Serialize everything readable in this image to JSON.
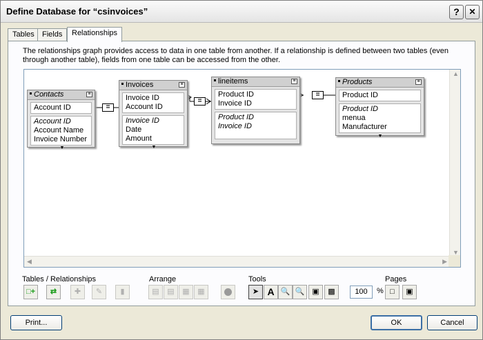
{
  "window": {
    "title": "Define Database for “csinvoices”",
    "help_btn": "?",
    "close_btn": "✕"
  },
  "tabs": [
    {
      "label": "Tables"
    },
    {
      "label": "Fields"
    },
    {
      "label": "Relationships",
      "active": true
    }
  ],
  "description": "The relationships graph provides access to data in one table from another. If a relationship is defined between two tables (even through another table), fields from one table can be accessed from the other.",
  "graph": {
    "tables": [
      {
        "name": "Contacts",
        "italic": true,
        "keys": [
          "Account ID"
        ],
        "fields": [
          "Account ID",
          "Account Name",
          "Invoice Number"
        ],
        "italic_fields": [
          0
        ]
      },
      {
        "name": "Invoices",
        "italic": false,
        "keys": [
          "Invoice ID",
          "Account ID"
        ],
        "fields": [
          "Invoice ID",
          "Date",
          "Amount"
        ],
        "italic_fields": [
          0
        ]
      },
      {
        "name": "lineitems",
        "italic": false,
        "keys": [
          "Product ID",
          "Invoice ID"
        ],
        "fields": [
          "Product ID",
          "Invoice ID"
        ],
        "italic_fields": [
          0,
          1
        ]
      },
      {
        "name": "Products",
        "italic": true,
        "keys": [
          "Product ID"
        ],
        "fields": [
          "Product ID",
          "menua",
          "Manufacturer"
        ],
        "italic_fields": [
          0
        ]
      }
    ],
    "relationship_symbol": "="
  },
  "toolbar": {
    "groups": [
      {
        "label": "Tables / Relationships"
      },
      {
        "label": "Arrange"
      },
      {
        "label": "Tools"
      },
      {
        "label": "Pages"
      }
    ],
    "tools_text_icon": "A",
    "zoom": "100",
    "zoom_unit": "%"
  },
  "buttons": {
    "print": "Print...",
    "ok": "OK",
    "cancel": "Cancel"
  },
  "colors": {
    "dialog_bg": "#ece9d8",
    "panel_bg": "#fcfcfe",
    "table_header": "#d0d0d0"
  }
}
